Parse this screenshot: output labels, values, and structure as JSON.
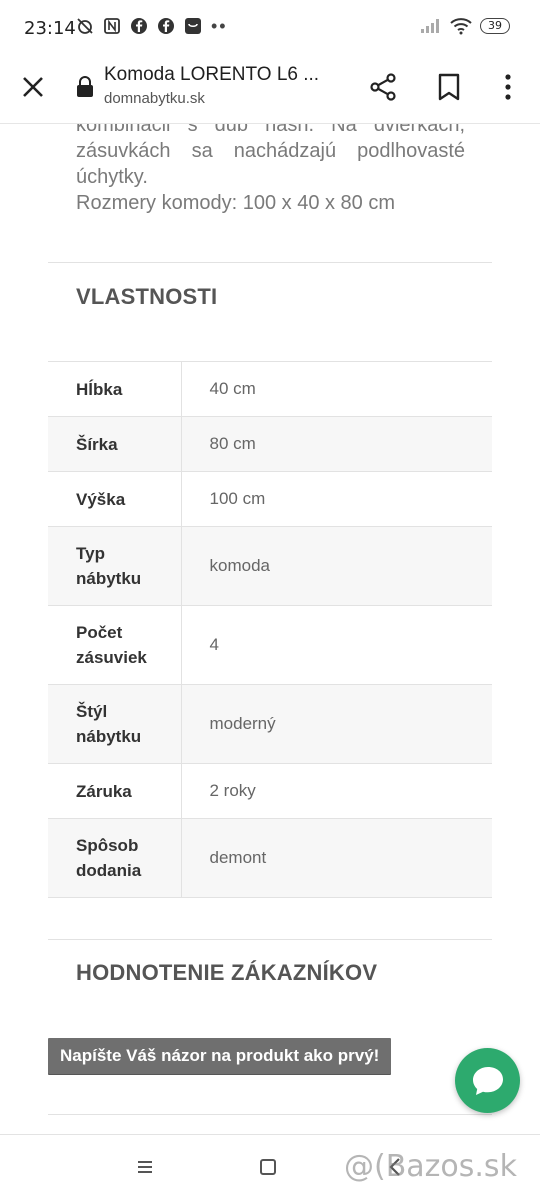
{
  "status_bar": {
    "time": "23:14",
    "battery": "39",
    "icons_left": [
      "muted-alarm-icon",
      "nfc-icon",
      "facebook-icon",
      "facebook-icon",
      "shopping-icon",
      "more-dots-icon"
    ],
    "icons_right": [
      "signal-icon",
      "wifi-icon",
      "battery-icon"
    ]
  },
  "browser": {
    "title": "Komoda LORENTO L6 ...",
    "url": "domnabytku.sk"
  },
  "description": {
    "line1": "kombinácii s dub nash. Na dvierkach, zásuvkách sa nachádzajú podlhovasté úchytky.",
    "line2": "Rozmery komody: 100 x 40 x 80 cm"
  },
  "properties": {
    "title": "VLASTNOSTI",
    "rows": [
      {
        "label": "Hĺbka",
        "value": "40 cm"
      },
      {
        "label": "Šírka",
        "value": "80 cm"
      },
      {
        "label": "Výška",
        "value": "100 cm"
      },
      {
        "label": "Typ nábytku",
        "value": "komoda"
      },
      {
        "label": "Počet zásuviek",
        "value": "4"
      },
      {
        "label": "Štýl nábytku",
        "value": "moderný"
      },
      {
        "label": "Záruka",
        "value": "2 roky"
      },
      {
        "label": "Spôsob dodania",
        "value": "demont"
      }
    ]
  },
  "reviews": {
    "title": "HODNOTENIE ZÁKAZNÍKOV",
    "button_label": "Napíšte Váš názor na produkt ako prvý!"
  },
  "colors": {
    "chat_accent": "#2daa6e",
    "button_bg": "#6f6f6f"
  },
  "watermark": "@(Bazos.sk"
}
